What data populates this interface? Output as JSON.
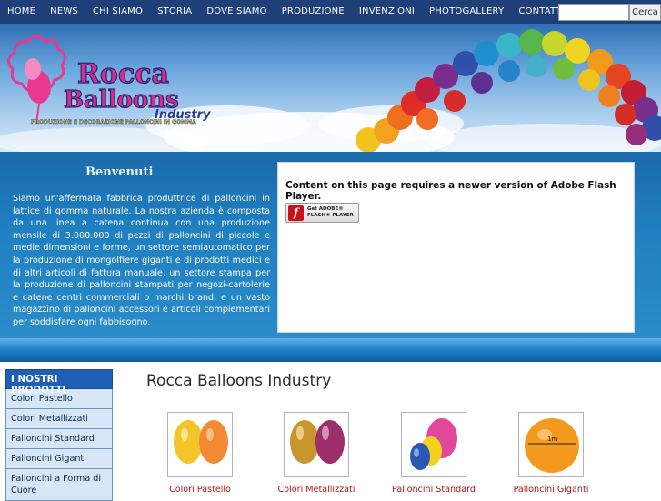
{
  "nav": {
    "items": [
      "HOME",
      "NEWS",
      "CHI SIAMO",
      "STORIA",
      "DOVE SIAMO",
      "PRODUZIONE",
      "INVENZIONI",
      "PHOTOGALLERY",
      "CONTATTI"
    ],
    "search_placeholder": "",
    "search_button": "Cerca"
  },
  "banner": {
    "logo_line1": "Rocca",
    "logo_line2": "Balloons",
    "logo_line3": "Industry",
    "tagline": "PRODUZIONE E DECORAZIONE PALLONCINI IN GOMMA"
  },
  "welcome": {
    "title": "Benvenuti",
    "text": "Siamo un'affermata fabbrica produttrice di palloncini in lattice di gomma naturale. La nostra azienda è composta da una linea a catena continua con una produzione mensile di 3.000.000 di pezzi di palloncini di piccole e medie dimensioni e forme, un settore semiautomatico per la produzione di mongolfiere giganti e di prodotti medici e di altri articoli di fattura manuale, un settore stampa per la produzione di palloncini stampati per negozi-cartolerie e catene centri commerciali o marchi brand, e un vasto magazzino di palloncini accessori e articoli complementari per soddisfare ogni fabbisogno."
  },
  "flash": {
    "message": "Content on this page requires a newer version of Adobe Flash Player.",
    "button_line1": "Get ADOBE®",
    "button_line2": "FLASH® PLAYER"
  },
  "sidebar": {
    "header": "I NOSTRI PRODOTTI",
    "items": [
      "Colori Pastello",
      "Colori Metallizzati",
      "Palloncini Standard",
      "Palloncini Giganti",
      "Palloncini a Forma di Cuore"
    ]
  },
  "main": {
    "title": "Rocca Balloons Industry",
    "products": [
      "Colori Pastello",
      "Colori Metallizzati",
      "Palloncini Standard",
      "Palloncini Giganti"
    ],
    "giant_label": "1m"
  },
  "colors": {
    "nav_bg": "#1f3f78",
    "accent_red": "#b4141a",
    "sidebar_header": "#1f5fb4",
    "sidebar_item": "#d6e6f6"
  }
}
